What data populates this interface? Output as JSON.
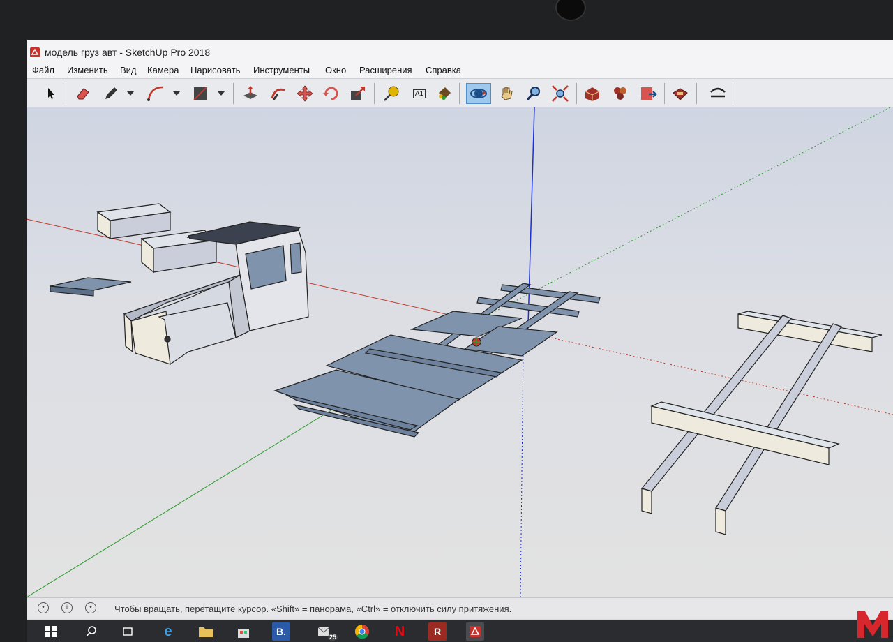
{
  "window": {
    "title": "модель груз авт - SketchUp Pro 2018"
  },
  "menu": [
    "Файл",
    "Изменить",
    "Вид",
    "Камера",
    "Нарисовать",
    "Инструменты",
    "Окно",
    "Расширения",
    "Справка"
  ],
  "toolbar": {
    "tools": [
      "select",
      "eraser",
      "pencil",
      "arc",
      "rectangle",
      "push-pull",
      "follow-me",
      "move",
      "rotate",
      "scale",
      "tape-measure",
      "text",
      "paint-bucket",
      "orbit",
      "pan",
      "zoom",
      "zoom-extents",
      "3d-warehouse",
      "components",
      "send-to-layout",
      "extension-warehouse",
      "sandbox"
    ],
    "active_tool": "orbit",
    "text_tool_label": "A1"
  },
  "status": {
    "text": "Чтобы вращать, перетащите курсор. «Shift» = панорама, «Ctrl» = отключить силу притяжения."
  },
  "taskbar": {
    "b_label": "B.",
    "badge": "25",
    "r_label": "R"
  },
  "colors": {
    "axis_red": "#c0392b",
    "axis_green": "#2e9b2e",
    "axis_blue": "#1a2fd6",
    "face": "#eeeadd",
    "face_back": "#7f93ad",
    "brand": "#d7272c"
  }
}
